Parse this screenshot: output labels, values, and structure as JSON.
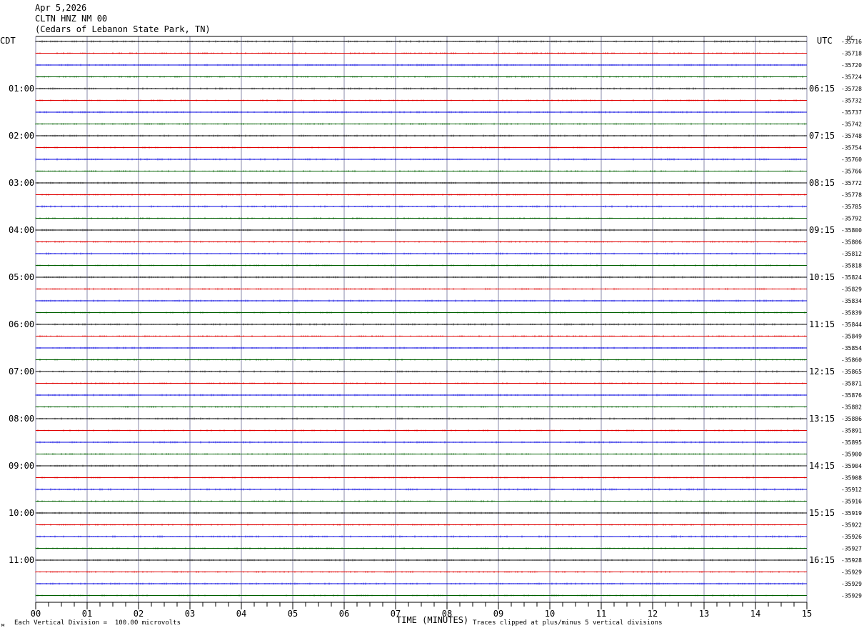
{
  "header": {
    "date": "Apr 5,2026",
    "station": "CLTN HNZ NM 00",
    "location": "(Cedars of Lebanon State Park, TN)"
  },
  "chart_data": {
    "type": "line",
    "title": "Apr 5,2026",
    "left_axis_label": "CDT",
    "right_axis_label": "UTC",
    "dc_label": "DC",
    "xlabel": "TIME (MINUTES)",
    "x_ticks": [
      "00",
      "01",
      "02",
      "03",
      "04",
      "05",
      "06",
      "07",
      "08",
      "09",
      "10",
      "11",
      "12",
      "13",
      "14",
      "15"
    ],
    "xlim": [
      0,
      15
    ],
    "grid": true,
    "trace_colors": [
      "#000000",
      "#e00000",
      "#0000e0",
      "#006000"
    ],
    "hour_labels_left": [
      "01:00",
      "02:00",
      "03:00",
      "04:00",
      "05:00",
      "06:00",
      "07:00",
      "08:00",
      "09:00",
      "10:00",
      "11:00"
    ],
    "hour_labels_right": [
      "06:15",
      "07:15",
      "08:15",
      "09:15",
      "10:15",
      "11:15",
      "12:15",
      "13:15",
      "14:15",
      "15:15",
      "16:15"
    ],
    "dc_offsets": [
      "-35716",
      "-35718",
      "-35720",
      "-35724",
      "-35728",
      "-35732",
      "-35737",
      "-35742",
      "-35748",
      "-35754",
      "-35760",
      "-35766",
      "-35772",
      "-35778",
      "-35785",
      "-35792",
      "-35800",
      "-35806",
      "-35812",
      "-35818",
      "-35824",
      "-35829",
      "-35834",
      "-35839",
      "-35844",
      "-35849",
      "-35854",
      "-35860",
      "-35865",
      "-35871",
      "-35876",
      "-35882",
      "-35886",
      "-35891",
      "-35895",
      "-35900",
      "-35904",
      "-35908",
      "-35912",
      "-35916",
      "-35919",
      "-35922",
      "-35926",
      "-35927",
      "-35928",
      "-35929",
      "-35929",
      "-35929"
    ],
    "footer_left": "Each Vertical Division =  100.00 microvolts",
    "footer_right": "Traces clipped at plus/minus 5 vertical divisions"
  }
}
